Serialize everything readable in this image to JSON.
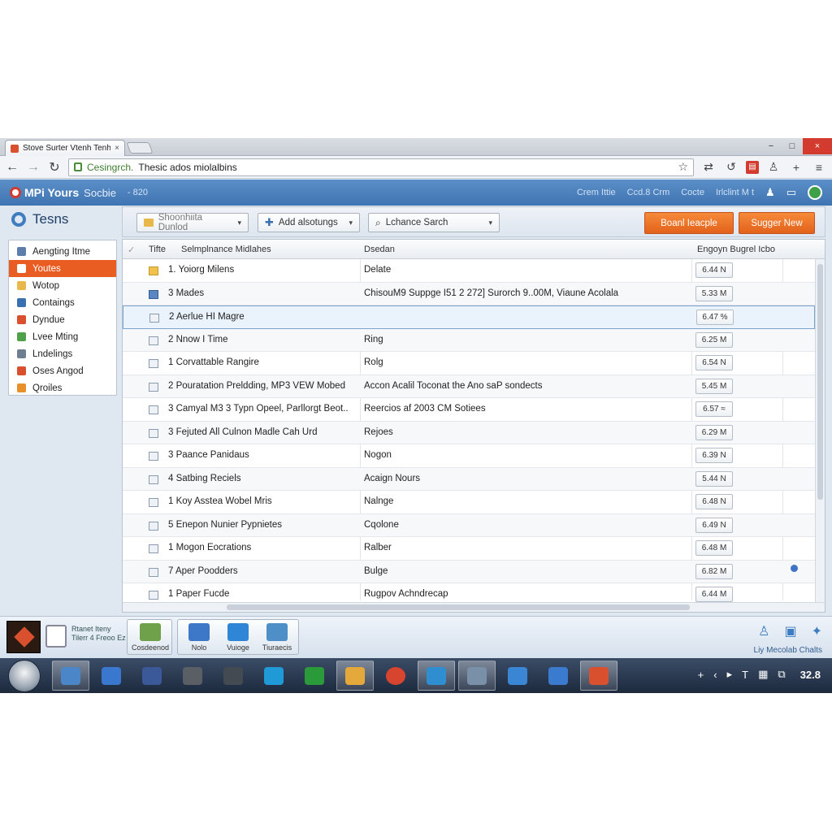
{
  "browser": {
    "tab_title": "Stove Surter Vtenh Tenhe-",
    "tab_close": "×",
    "window_min": "−",
    "window_max": "□",
    "window_close": "×",
    "url_secure_part": "Cesingrch.",
    "url_rest": "Thesic ados miolalbins"
  },
  "app": {
    "title": "MPi Yours",
    "subtitle": "Socbie",
    "subtitle_suffix": "- 820",
    "header_links": [
      "Crem Ittie",
      "Ccd.8 Crm",
      "Cocte",
      "Irlclint M t"
    ]
  },
  "side": {
    "title": "Tesns",
    "items": [
      {
        "label": "Aengting Itme",
        "color": "#5d7ea8"
      },
      {
        "label": "Youtes",
        "color": "#ffffff",
        "active": true
      },
      {
        "label": "Wotop",
        "color": "#e8b84a"
      },
      {
        "label": "Contaings",
        "color": "#3a6fb0"
      },
      {
        "label": "Dyndue",
        "color": "#d8502d"
      },
      {
        "label": "Lvee Mting",
        "color": "#4fa24a"
      },
      {
        "label": "Lndelings",
        "color": "#6f7f91"
      },
      {
        "label": "Oses Angod",
        "color": "#d8502d"
      },
      {
        "label": "Qroiles",
        "color": "#e8902a"
      }
    ]
  },
  "commands": {
    "folder_btn": "Shoonhiita Dunlod",
    "add_btn": "Add alsotungs",
    "search_placeholder": "Lchance Sarch",
    "primary_btn": "Boanl Ieacple",
    "secondary_btn": "Sugger New"
  },
  "table": {
    "headers": {
      "check": "✓",
      "type": "Tifte",
      "name": "Selmplnance Midlahes",
      "desc": "Dsedan",
      "size": "Engoyn Bugrel Icbo"
    },
    "rows": [
      {
        "icon": "folder",
        "name": "1. Yoiorg Milens",
        "desc": "Delate",
        "size": "6.44 N"
      },
      {
        "icon": "img",
        "name": "3 Mades",
        "desc": "ChisouM9 Suppge I51 2 272] Surorch 9..00M, Viaune Acolala",
        "size": "5.33 M"
      },
      {
        "icon": "doc",
        "name": "2 Aerlue HI Magre",
        "desc": "",
        "size": "6.47 %",
        "selected": true
      },
      {
        "icon": "doc",
        "name": "2 Nnow I Time",
        "desc": "Ring",
        "size": "6.25 M"
      },
      {
        "icon": "doc",
        "name": "1 Corvattable Rangire",
        "desc": "Rolg",
        "size": "6.54 N"
      },
      {
        "icon": "doc",
        "name": "2 Pouratation Preldding, MP3 VEW Mobed",
        "desc": "Accon Acalil Toconat the Ano saP sondects",
        "size": "5.45 M"
      },
      {
        "icon": "doc",
        "name": "3 Camyal M3 3 Typn Opeel, Parllorgt Beot..",
        "desc": "Reercios af 2003 CM Sotiees",
        "size": "6.57 ≈"
      },
      {
        "icon": "doc",
        "name": "3 Fejuted All Culnon Madle Cah Urd",
        "desc": "Rejoes",
        "size": "6.29 M"
      },
      {
        "icon": "doc",
        "name": "3 Paance Panidaus",
        "desc": "Nogon",
        "size": "6.39 N"
      },
      {
        "icon": "doc",
        "name": "4 Satbing Reciels",
        "desc": "Acaign Nours",
        "size": "5.44 N"
      },
      {
        "icon": "doc",
        "name": "1 Koy Asstea Wobel Mris",
        "desc": "Nalnge",
        "size": "6.48 N"
      },
      {
        "icon": "doc",
        "name": "5 Enepon Nunier Pypnietes",
        "desc": "Cqolone",
        "size": "6.49 N"
      },
      {
        "icon": "doc",
        "name": "1 Mogon Eocrations",
        "desc": "Ralber",
        "size": "6.48 M"
      },
      {
        "icon": "doc",
        "name": "7 Aper Poodders",
        "desc": "Bulge",
        "size": "6.82 M"
      },
      {
        "icon": "doc",
        "name": "1 Paper Fucde",
        "desc": "Rugpov Achndrecap",
        "size": "6.44 M"
      }
    ]
  },
  "bottom": {
    "promo_text": "Rtanet Iteny Tilerr 4 Freoo Ez",
    "quick1": [
      {
        "label": "Cosdeenod",
        "color": "#6fa04a"
      }
    ],
    "quick2": [
      {
        "label": "Nolo",
        "color": "#3c78c7"
      },
      {
        "label": "Vuioge",
        "color": "#2f86d6"
      },
      {
        "label": "Tiuraecis",
        "color": "#4f8fc8"
      }
    ],
    "social_caption": "Liy Mecolab Chalts"
  },
  "taskbar": {
    "apps": [
      {
        "name": "tool-app",
        "color": "#4b86c8"
      },
      {
        "name": "arrow-app",
        "color": "#3a78d0"
      },
      {
        "name": "facebook-app",
        "color": "#3b5998"
      },
      {
        "name": "gamepad-app",
        "color": "#5a5f66"
      },
      {
        "name": "disc-app",
        "color": "#444a52"
      },
      {
        "name": "skype-app",
        "color": "#1f9ad6"
      },
      {
        "name": "terminal-app",
        "color": "#2b9a3a"
      },
      {
        "name": "calendar-app",
        "color": "#e5a83b"
      },
      {
        "name": "chrome-app",
        "color": "#d8452e"
      },
      {
        "name": "media-app",
        "color": "#2f8ecf"
      },
      {
        "name": "window-app",
        "color": "#7a8fa8"
      },
      {
        "name": "share-app",
        "color": "#3b86d4"
      },
      {
        "name": "bluetooth-app",
        "color": "#3a7bd0"
      },
      {
        "name": "color-app",
        "color": "#d8502d"
      }
    ],
    "tray_icons": [
      "+",
      "‹",
      "▸",
      "T",
      "▦",
      "⧉"
    ],
    "clock": "32.8"
  }
}
